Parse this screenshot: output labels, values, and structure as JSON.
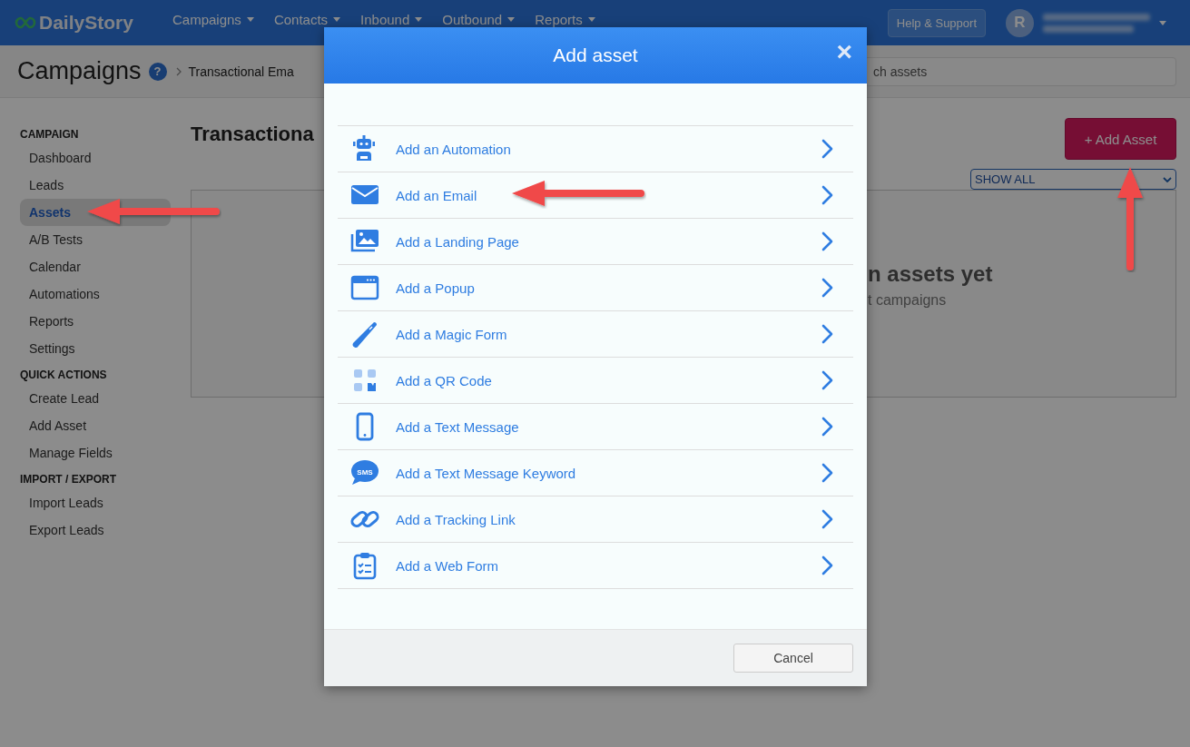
{
  "nav": {
    "logo": "DailyStory",
    "menus": [
      {
        "label": "Campaigns"
      },
      {
        "label": "Contacts"
      },
      {
        "label": "Inbound"
      },
      {
        "label": "Outbound"
      },
      {
        "label": "Reports"
      }
    ],
    "help_button": "Help & Support",
    "avatar": "R"
  },
  "header": {
    "title": "Campaigns",
    "help": "?",
    "breadcrumb": "Transactional Ema",
    "search": {
      "placeholder": "ch assets"
    }
  },
  "sidebar": {
    "sections": [
      {
        "heading": "CAMPAIGN",
        "items": [
          {
            "label": "Dashboard",
            "selected": false
          },
          {
            "label": "Leads",
            "selected": false
          },
          {
            "label": "Assets",
            "selected": true
          },
          {
            "label": "A/B Tests",
            "selected": false
          },
          {
            "label": "Calendar",
            "selected": false
          },
          {
            "label": "Automations",
            "selected": false
          },
          {
            "label": "Reports",
            "selected": false
          },
          {
            "label": "Settings",
            "selected": false
          }
        ]
      },
      {
        "heading": "QUICK ACTIONS",
        "items": [
          {
            "label": "Create Lead",
            "selected": false
          },
          {
            "label": "Add Asset",
            "selected": false
          },
          {
            "label": "Manage Fields",
            "selected": false
          }
        ]
      },
      {
        "heading": "IMPORT / EXPORT",
        "items": [
          {
            "label": "Import Leads",
            "selected": false
          },
          {
            "label": "Export Leads",
            "selected": false
          }
        ]
      }
    ]
  },
  "main": {
    "title": "Transactiona",
    "add_button": "+ Add Asset",
    "filter": "SHOW ALL",
    "empty_title": "n assets yet",
    "empty_text": "t campaigns"
  },
  "modal": {
    "title": "Add asset",
    "close": "×",
    "items": [
      {
        "label": "Add an Automation",
        "kind": "robot"
      },
      {
        "label": "Add an Email",
        "kind": "envelope"
      },
      {
        "label": "Add a Landing Page",
        "kind": "images"
      },
      {
        "label": "Add a Popup",
        "kind": "window"
      },
      {
        "label": "Add a Magic Form",
        "kind": "pen"
      },
      {
        "label": "Add a QR Code",
        "kind": "qr"
      },
      {
        "label": "Add a Text Message",
        "kind": "phone"
      },
      {
        "label": "Add a Text Message Keyword",
        "kind": "sms",
        "badge": "SMS"
      },
      {
        "label": "Add a Tracking Link",
        "kind": "link"
      },
      {
        "label": "Add a Web Form",
        "kind": "clipboard"
      }
    ],
    "cancel": "Cancel"
  }
}
